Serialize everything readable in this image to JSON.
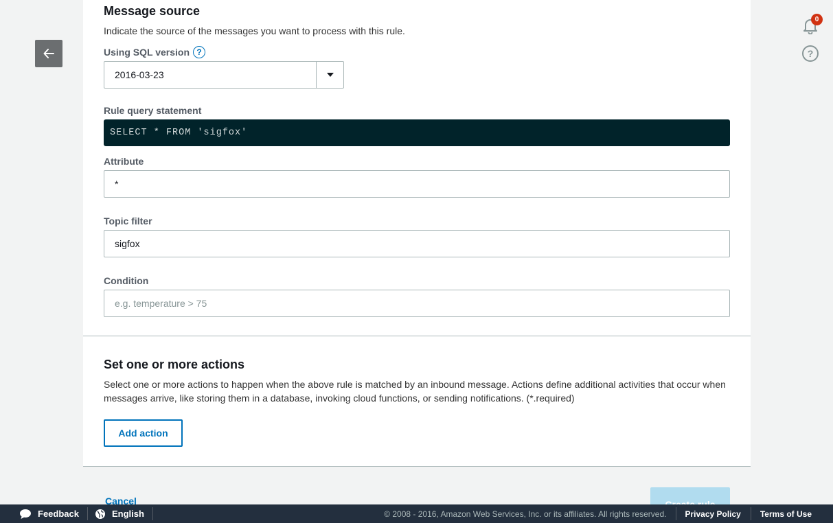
{
  "notifications": {
    "count": "0",
    "help": "?"
  },
  "message_source": {
    "title": "Message source",
    "description": "Indicate the source of the messages you want to process with this rule.",
    "sql_version_label": "Using SQL version",
    "sql_version_value": "2016-03-23",
    "query_label": "Rule query statement",
    "query": "SELECT * FROM 'sigfox'",
    "attribute_label": "Attribute",
    "attribute_value": "*",
    "topic_label": "Topic filter",
    "topic_value": "sigfox",
    "condition_label": "Condition",
    "condition_placeholder": "e.g. temperature > 75"
  },
  "actions": {
    "title": "Set one or more actions",
    "description_line1": "Select one or more actions to happen when the above rule is matched by an inbound message. Actions define additional activities that occur when",
    "description_line2": "messages arrive, like storing them in a database, invoking cloud functions, or sending notifications. (*.required)",
    "add_button": "Add action"
  },
  "form_footer": {
    "cancel": "Cancel",
    "create": "Create rule"
  },
  "footer": {
    "feedback": "Feedback",
    "language": "English",
    "copyright": "© 2008 - 2016, Amazon Web Services, Inc. or its affiliates. All rights reserved.",
    "privacy": "Privacy Policy",
    "terms": "Terms of Use"
  },
  "colors": {
    "accent": "#0073bb",
    "code_bg": "#01232a",
    "footer_bg": "#232f3e",
    "badge": "#d13212"
  }
}
